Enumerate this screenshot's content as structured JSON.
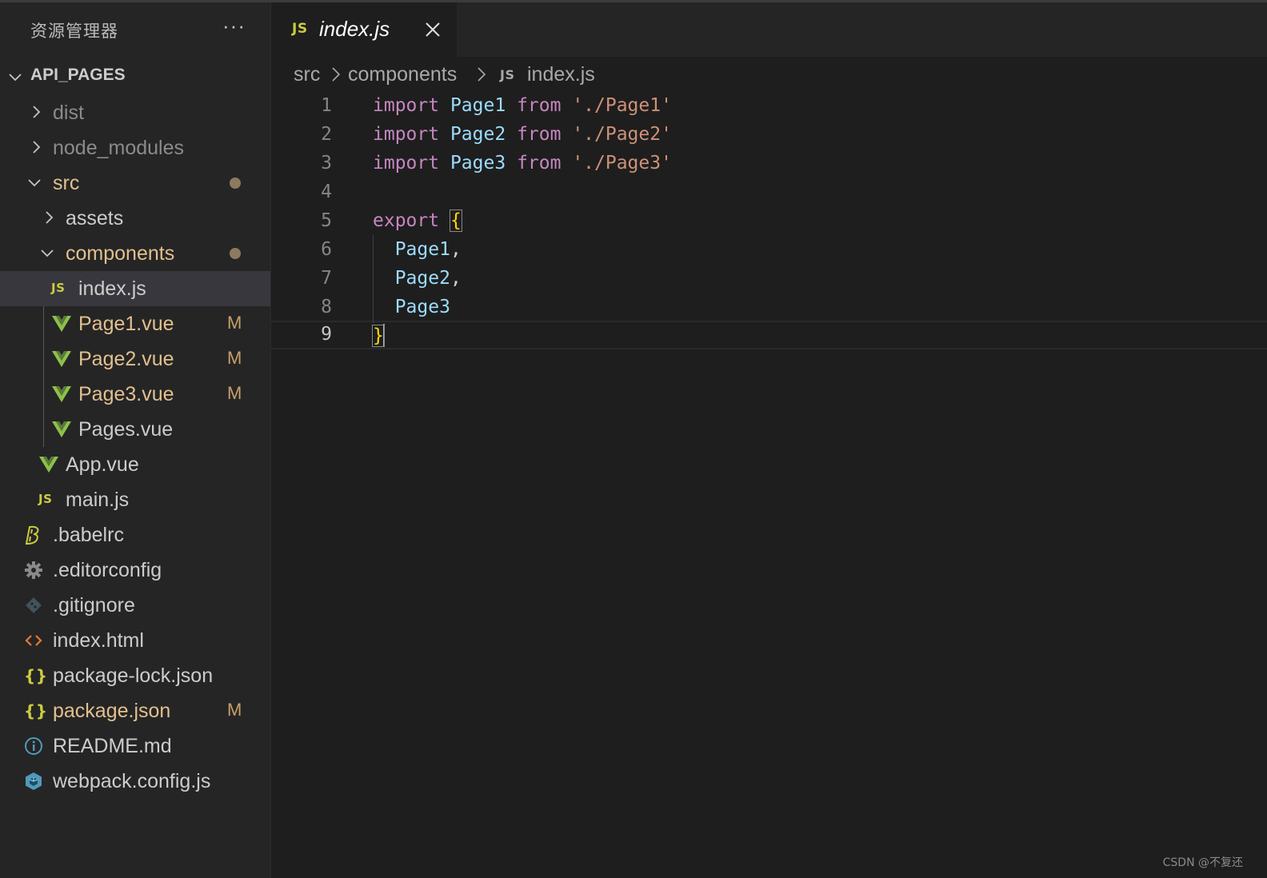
{
  "sidebar": {
    "title": "资源管理器",
    "more_label": "···",
    "root_label": "API_PAGES",
    "items": [
      {
        "label": "dist",
        "badge": ""
      },
      {
        "label": "node_modules",
        "badge": ""
      },
      {
        "label": "src",
        "badge": ""
      },
      {
        "label": "assets",
        "badge": ""
      },
      {
        "label": "components",
        "badge": ""
      },
      {
        "label": "index.js",
        "badge": ""
      },
      {
        "label": "Page1.vue",
        "badge": "M"
      },
      {
        "label": "Page2.vue",
        "badge": "M"
      },
      {
        "label": "Page3.vue",
        "badge": "M"
      },
      {
        "label": "Pages.vue",
        "badge": ""
      },
      {
        "label": "App.vue",
        "badge": ""
      },
      {
        "label": "main.js",
        "badge": ""
      },
      {
        "label": ".babelrc",
        "badge": ""
      },
      {
        "label": ".editorconfig",
        "badge": ""
      },
      {
        "label": ".gitignore",
        "badge": ""
      },
      {
        "label": "index.html",
        "badge": ""
      },
      {
        "label": "package-lock.json",
        "badge": ""
      },
      {
        "label": "package.json",
        "badge": "M"
      },
      {
        "label": "README.md",
        "badge": ""
      },
      {
        "label": "webpack.config.js",
        "badge": ""
      }
    ],
    "js_icon_text": "JS",
    "json_icon_text": "{}"
  },
  "tab": {
    "icon_text": "JS",
    "label": "index.js"
  },
  "breadcrumb": {
    "part1": "src",
    "part2": "components",
    "icon_text": "JS",
    "part3": "index.js"
  },
  "editor": {
    "line_numbers": [
      "1",
      "2",
      "3",
      "4",
      "5",
      "6",
      "7",
      "8",
      "9"
    ],
    "lines": {
      "l1": {
        "kw1": "import",
        "id": "Page1",
        "kw2": "from",
        "str": "'./Page1'"
      },
      "l2": {
        "kw1": "import",
        "id": "Page2",
        "kw2": "from",
        "str": "'./Page2'"
      },
      "l3": {
        "kw1": "import",
        "id": "Page3",
        "kw2": "from",
        "str": "'./Page3'"
      },
      "l5": {
        "kw": "export",
        "brace": "{"
      },
      "l6": {
        "id": "Page1",
        "punc": ","
      },
      "l7": {
        "id": "Page2",
        "punc": ","
      },
      "l8": {
        "id": "Page3"
      },
      "l9": {
        "brace": "}"
      }
    }
  },
  "watermark": "CSDN @不复还",
  "colors": {
    "keyword": "#c586c0",
    "identifier": "#9cdcfe",
    "string": "#ce9178",
    "modified": "#e2c08d"
  }
}
